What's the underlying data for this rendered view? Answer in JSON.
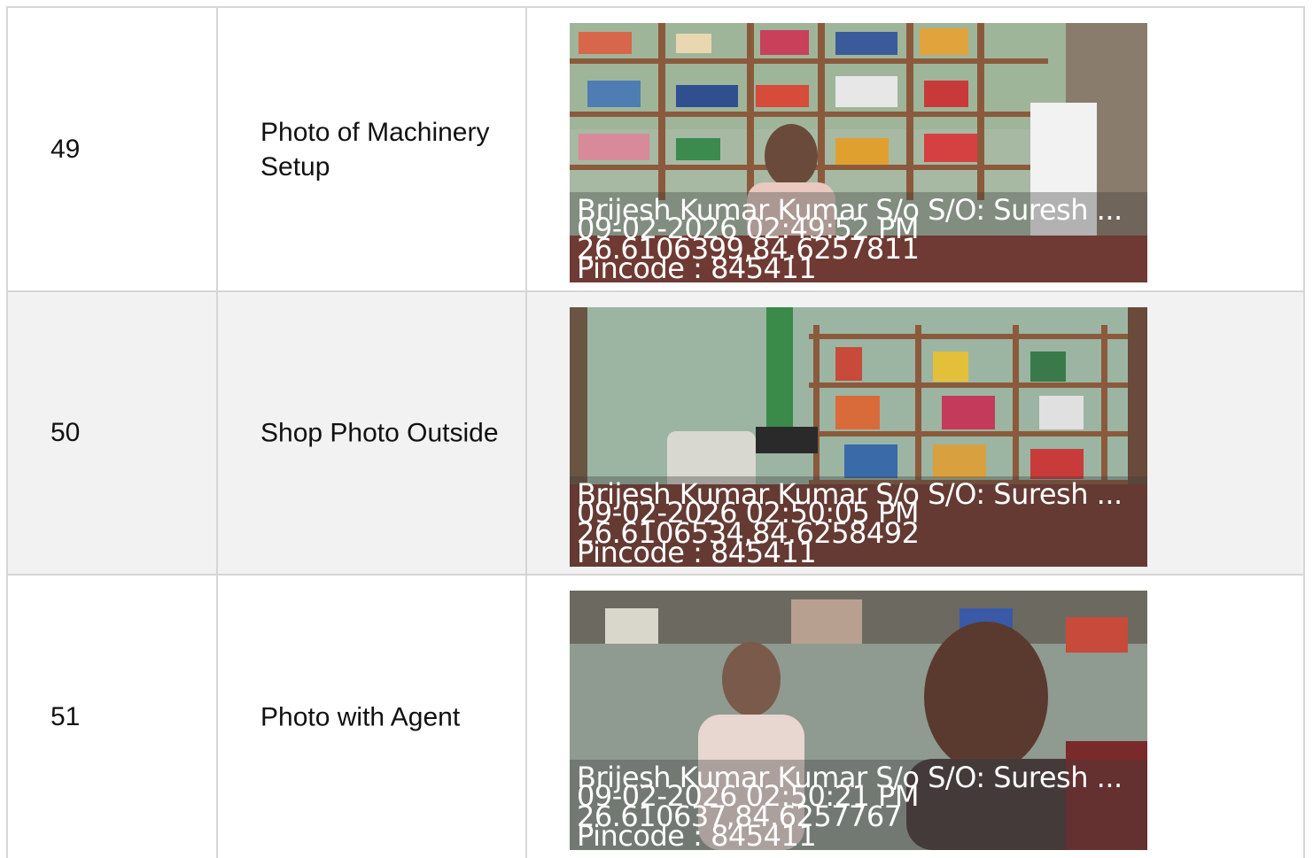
{
  "rows": [
    {
      "number": "49",
      "label": "Photo of Machinery Setup",
      "photo": {
        "name_line": "Brijesh Kumar Kumar S/o S/O: Suresh ...",
        "timestamp": "09-02-2026 02:49:52 PM",
        "coordinates": "26.6106399,84.6257811",
        "pincode": "Pincode : 845411"
      }
    },
    {
      "number": "50",
      "label": "Shop Photo Outside",
      "photo": {
        "name_line": "Brijesh Kumar Kumar S/o S/O: Suresh ...",
        "timestamp": "09-02-2026 02:50:05 PM",
        "coordinates": "26.6106534,84.6258492",
        "pincode": "Pincode : 845411"
      }
    },
    {
      "number": "51",
      "label": "Photo with Agent",
      "photo": {
        "name_line": "Brijesh Kumar Kumar S/o S/O: Suresh ...",
        "timestamp": "09-02-2026 02:50:21 PM",
        "coordinates": "26.610637,84.6257767",
        "pincode": "Pincode : 845411"
      }
    }
  ],
  "colors": {
    "grid_line": "#d6d6d6",
    "alt_row_bg": "#f2f2f2",
    "overlay_text": "#ffffff"
  }
}
